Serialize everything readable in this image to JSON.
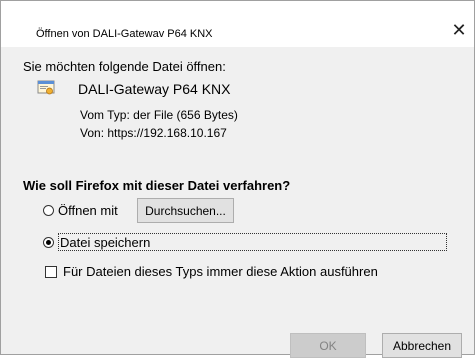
{
  "window": {
    "title": "Öffnen von DALI-Gatewav P64 KNX",
    "close_symbol": "✕"
  },
  "file": {
    "intro": "Sie möchten folgende Datei öffnen:",
    "icon": "file-icon",
    "name": "DALI-Gateway P64 KNX",
    "type_label": "Vom Typ:",
    "type_value": "der File (656 Bytes)",
    "from_label": "Von:",
    "from_value": "https://192.168.10.167"
  },
  "action": {
    "question": "Wie soll Firefox mit dieser Datei verfahren?",
    "open_with_label": "Öffnen mit",
    "browse_label": "Durchsuchen...",
    "save_label": "Datei speichern",
    "always_label": "Für Dateien dieses Typs immer diese Aktion ausführen",
    "selected_option": "save",
    "always_checked": false
  },
  "buttons": {
    "ok": "OK",
    "cancel": "Abbrechen"
  }
}
